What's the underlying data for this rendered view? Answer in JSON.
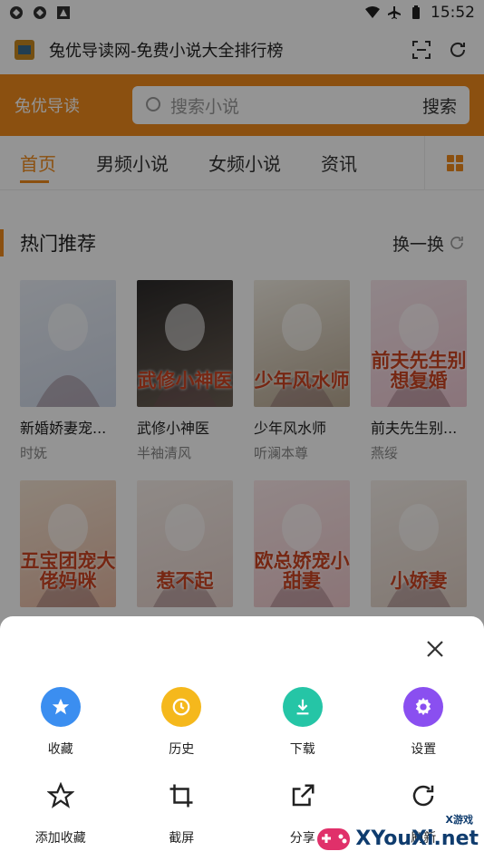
{
  "status_bar": {
    "time": "15:52"
  },
  "browser": {
    "page_title": "兔优导读网-免费小说大全排行榜"
  },
  "site": {
    "brand": "兔优导读",
    "search_placeholder": "搜索小说",
    "search_button": "搜索",
    "tabs": [
      {
        "label": "首页",
        "active": true
      },
      {
        "label": "男频小说",
        "active": false
      },
      {
        "label": "女频小说",
        "active": false
      },
      {
        "label": "资讯",
        "active": false
      }
    ]
  },
  "section": {
    "title": "热门推荐",
    "more": "换一换"
  },
  "books_row1": [
    {
      "name": "新婚娇妻宠...",
      "author": "时妩",
      "cover_text": "",
      "c1": "#e9eef6",
      "c2": "#cfd8e8"
    },
    {
      "name": "武修小神医",
      "author": "半袖清风",
      "cover_text": "武修小神医",
      "c1": "#2c2a2a",
      "c2": "#6e6256"
    },
    {
      "name": "少年风水师",
      "author": "听澜本尊",
      "cover_text": "少年风水师",
      "c1": "#f1ece2",
      "c2": "#b9a992"
    },
    {
      "name": "前夫先生别...",
      "author": "燕绥",
      "cover_text": "前夫先生别想复婚",
      "c1": "#f8e7ec",
      "c2": "#efc9d4"
    }
  ],
  "books_row2": [
    {
      "cover_text": "五宝团宠大佬妈咪",
      "c1": "#f3e3d2",
      "c2": "#e7b9a2"
    },
    {
      "cover_text": "惹不起",
      "c1": "#f6eee9",
      "c2": "#e7d2cc"
    },
    {
      "cover_text": "欧总娇宠小甜妻",
      "c1": "#fbe9ea",
      "c2": "#f0c9cd"
    },
    {
      "cover_text": "小娇妻",
      "c1": "#f5efea",
      "c2": "#e1d0c5"
    }
  ],
  "menu": {
    "row1": [
      {
        "label": "收藏",
        "color": "#3b8ef0",
        "icon": "star-icon"
      },
      {
        "label": "历史",
        "color": "#f5b81c",
        "icon": "clock-icon"
      },
      {
        "label": "下载",
        "color": "#25c5a6",
        "icon": "download-icon"
      },
      {
        "label": "设置",
        "color": "#8a4ff0",
        "icon": "gear-icon"
      }
    ],
    "row2": [
      {
        "label": "添加收藏",
        "icon": "star-outline-icon"
      },
      {
        "label": "截屏",
        "icon": "crop-icon"
      },
      {
        "label": "分享",
        "icon": "share-icon"
      },
      {
        "label": "刷新",
        "icon": "refresh-icon"
      }
    ]
  },
  "watermark": {
    "small": "X游戏",
    "big": "XYouXi.net"
  }
}
